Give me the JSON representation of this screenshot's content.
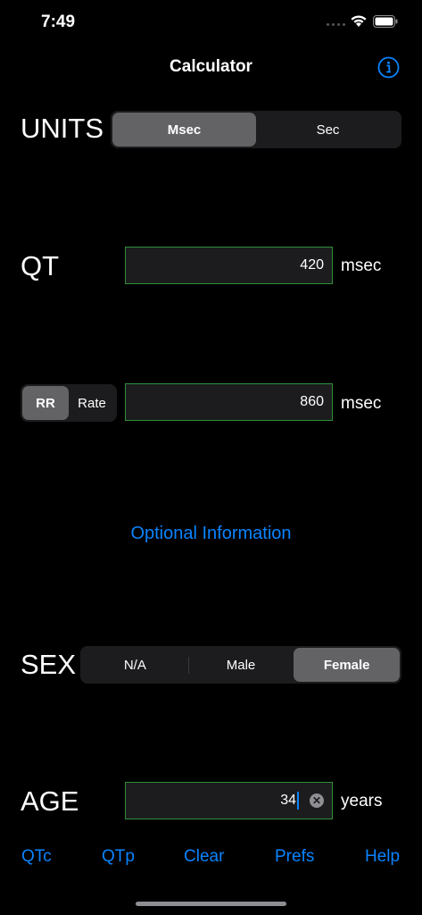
{
  "status_bar": {
    "time": "7:49"
  },
  "nav": {
    "title": "Calculator",
    "info_icon": "info-circle-icon"
  },
  "units": {
    "label": "UNITS",
    "options": [
      "Msec",
      "Sec"
    ],
    "selected": "Msec"
  },
  "qt": {
    "label": "QT",
    "value": "420",
    "unit": "msec"
  },
  "rr": {
    "options": [
      "RR",
      "Rate"
    ],
    "selected": "RR",
    "value": "860",
    "unit": "msec"
  },
  "optional_link": "Optional Information",
  "sex": {
    "label": "SEX",
    "options": [
      "N/A",
      "Male",
      "Female"
    ],
    "selected": "Female"
  },
  "age": {
    "label": "AGE",
    "value": "34",
    "unit": "years"
  },
  "toolbar": {
    "items": [
      "QTc",
      "QTp",
      "Clear",
      "Prefs",
      "Help"
    ]
  },
  "colors": {
    "accent": "#0a84ff",
    "field_border": "#2f8f3a",
    "segment_selected": "#636366"
  }
}
